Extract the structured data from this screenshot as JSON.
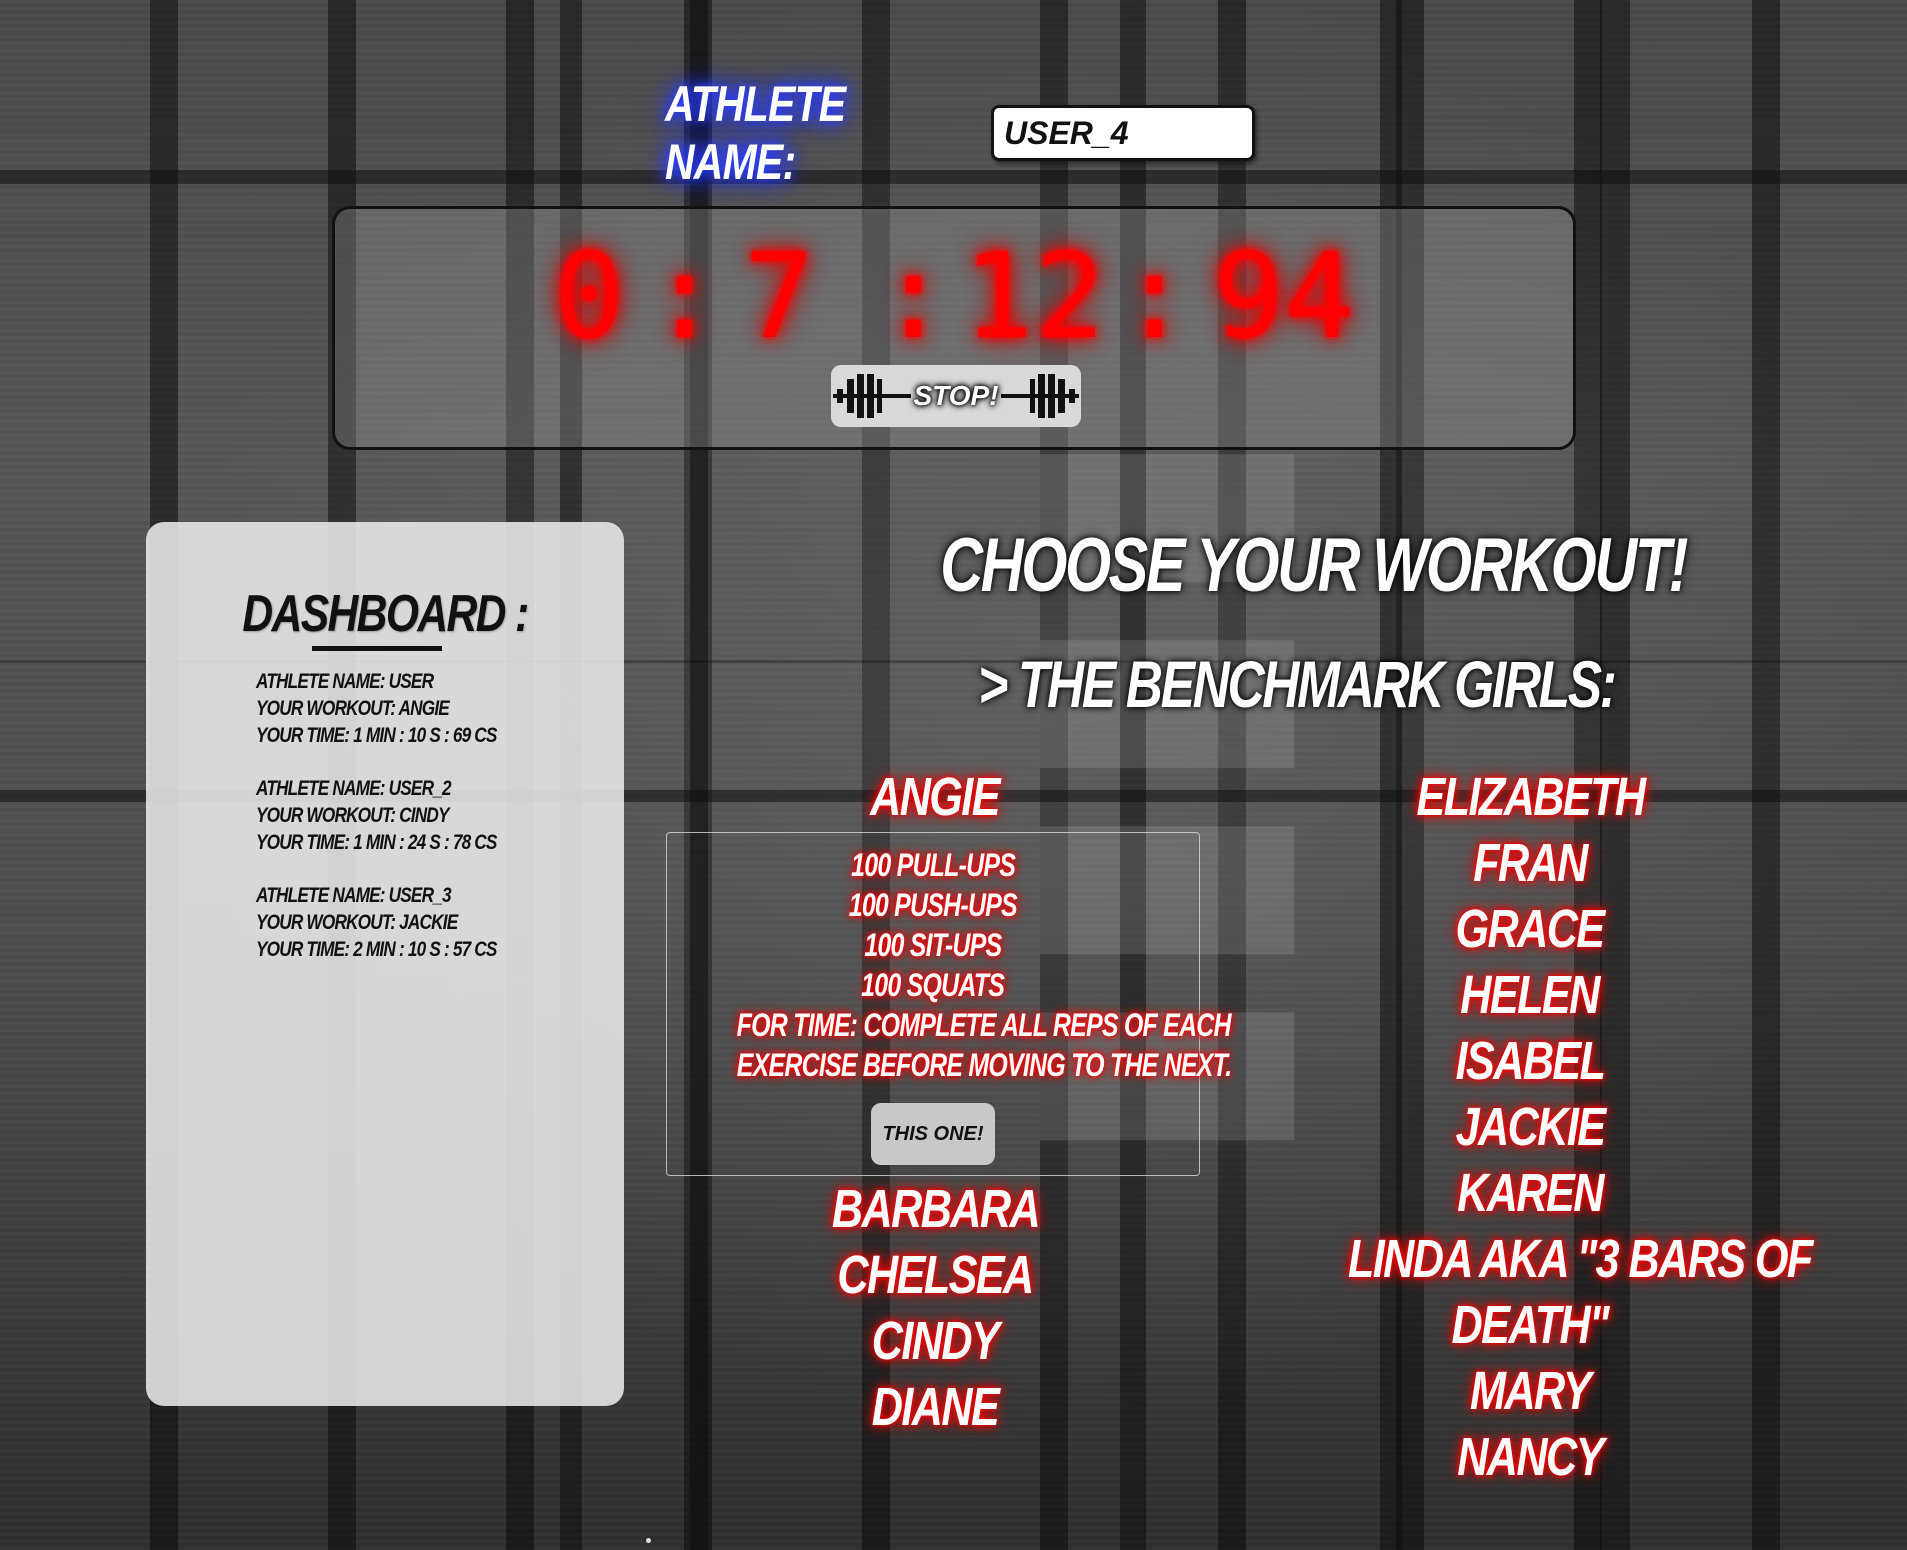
{
  "athlete": {
    "label": "ATHLETE NAME:",
    "input_value": "USER_4"
  },
  "timer": {
    "minutes_tens": "0",
    "minutes_ones": "7",
    "seconds": "12",
    "centiseconds": "94",
    "separator": ":",
    "digit_color": "#ff0000",
    "stop_label": "STOP!",
    "stop_icon": "barbell-icon"
  },
  "dashboard": {
    "title": "DASHBOARD :",
    "entries": [
      {
        "name": "ATHLETE NAME: USER",
        "workout": "YOUR WORKOUT: ANGIE",
        "time": "YOUR TIME: 1 MIN : 10 S : 69 CS"
      },
      {
        "name": "ATHLETE NAME: USER_2",
        "workout": "YOUR WORKOUT: CINDY",
        "time": "YOUR TIME: 1 MIN : 24 S : 78 CS"
      },
      {
        "name": "ATHLETE NAME: USER_3",
        "workout": "YOUR WORKOUT: JACKIE",
        "time": "YOUR TIME: 2 MIN : 10 S : 57 CS"
      }
    ]
  },
  "workouts": {
    "title": "CHOOSE YOUR WORKOUT!",
    "category": "> THE BENCHMARK GIRLS:",
    "left_column": [
      "ANGIE",
      "BARBARA",
      "CHELSEA",
      "CINDY",
      "DIANE"
    ],
    "right_column": [
      "ELIZABETH",
      "FRAN",
      "GRACE",
      "HELEN",
      "ISABEL",
      "JACKIE",
      "KAREN",
      "LINDA AKA \"3 BARS OF",
      "DEATH\"",
      "MARY",
      "NANCY"
    ],
    "selected": {
      "lines": [
        "100 PULL-UPS",
        "100 PUSH-UPS",
        "100 SIT-UPS",
        "100 SQUATS",
        "FOR TIME: COMPLETE ALL REPS OF EACH",
        "EXERCISE BEFORE MOVING TO THE NEXT."
      ],
      "button_label": "THIS ONE!"
    },
    "glow_color": "#ff0000"
  }
}
